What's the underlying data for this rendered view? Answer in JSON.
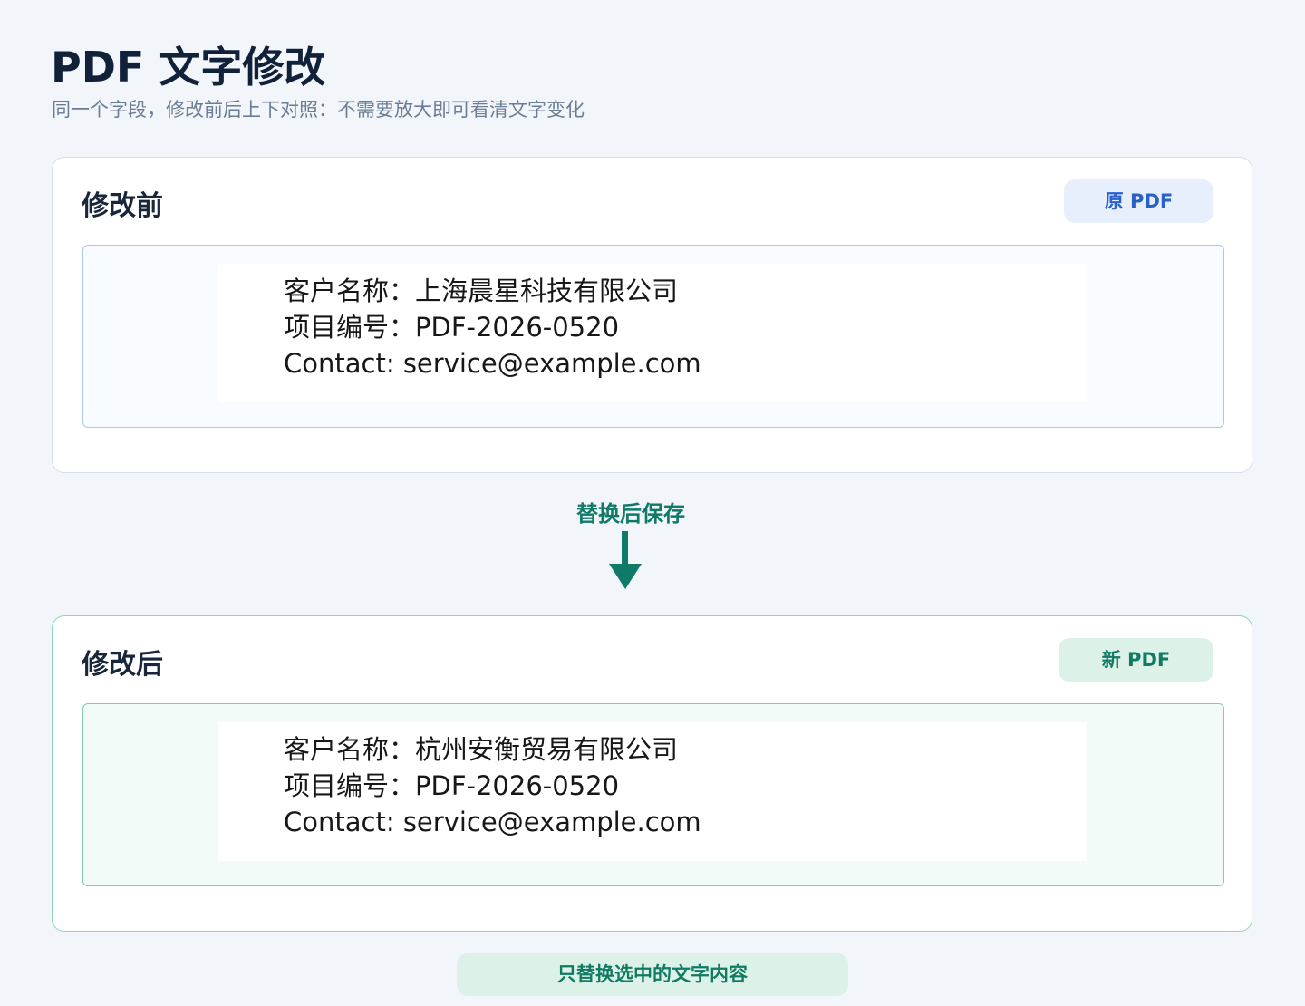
{
  "page": {
    "title": "PDF 文字修改",
    "subtitle": "同一个字段，修改前后上下对照：不需要放大即可看清文字变化"
  },
  "before": {
    "title": "修改前",
    "badge": "原 PDF",
    "lines": [
      "客户名称：上海晨星科技有限公司",
      "项目编号：PDF-2026-0520",
      "Contact: service@example.com"
    ]
  },
  "flow": {
    "label": "替换后保存",
    "icon": "arrow-down-icon"
  },
  "after": {
    "title": "修改后",
    "badge": "新 PDF",
    "lines": [
      "客户名称：杭州安衡贸易有限公司",
      "项目编号：PDF-2026-0520",
      "Contact: service@example.com"
    ]
  },
  "footer": {
    "note": "只替换选中的文字内容"
  },
  "colors": {
    "accent_blue": "#2a61c9",
    "accent_green": "#117a62",
    "background": "#f2f6fa"
  }
}
